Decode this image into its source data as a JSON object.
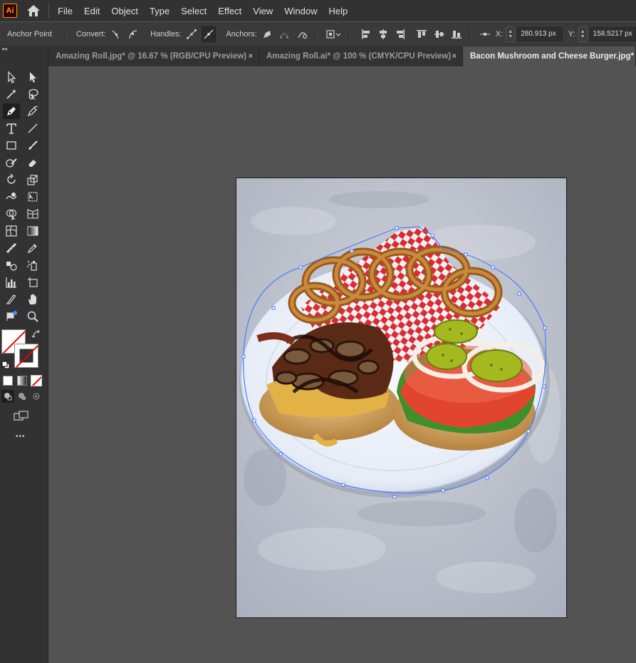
{
  "app": {
    "logo_text": "Ai"
  },
  "menu": {
    "items": [
      "File",
      "Edit",
      "Object",
      "Type",
      "Select",
      "Effect",
      "View",
      "Window",
      "Help"
    ]
  },
  "control_bar": {
    "tool_name": "Anchor Point",
    "convert_label": "Convert:",
    "handles_label": "Handles:",
    "anchors_label": "Anchors:",
    "x_label": "X:",
    "x_value": "280.913 px",
    "y_label": "Y:",
    "y_value": "158.5217 px"
  },
  "tabs": [
    {
      "label": "Amazing Roll.jpg* @ 16.67 % (RGB/CPU Preview)",
      "active": false,
      "close": "×"
    },
    {
      "label": "Amazing Roll.ai* @ 100 % (CMYK/CPU Preview)",
      "active": false,
      "close": "×"
    },
    {
      "label": "Bacon Mushroom and Cheese Burger.jpg* @",
      "active": true,
      "close": "×"
    }
  ],
  "toolbar": {
    "collapse_glyph": "◂◂",
    "more_glyph": "•••"
  },
  "colors": {
    "app_bg": "#535353",
    "panel_bg": "#323232",
    "accent_orange": "#ff9a00",
    "selection_blue": "#4a7cff"
  }
}
